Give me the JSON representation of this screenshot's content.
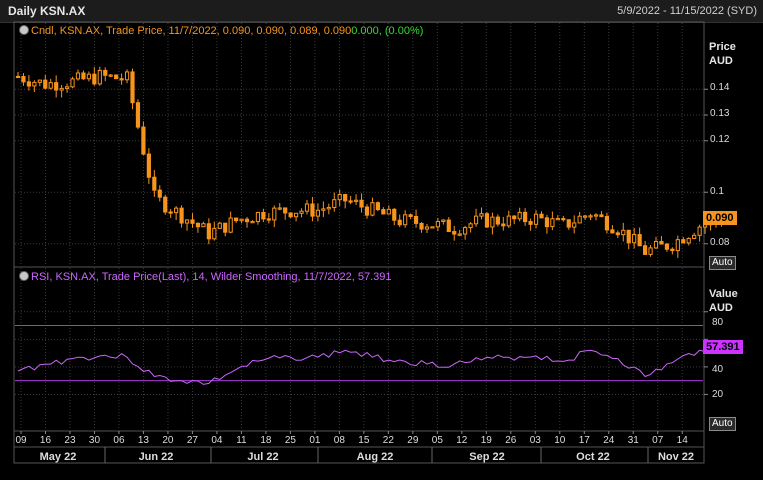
{
  "header": {
    "title": "Daily KSN.AX",
    "date_range": "5/9/2022 - 11/15/2022 (SYD)"
  },
  "price_panel": {
    "legend_prefix": "Cndl, KSN.AX, Trade Price, 11/7/2022, 0.090, 0.090, 0.089, 0.090",
    "legend_change": "0.000, (0.00%)",
    "axis_title_1": "Price",
    "axis_title_2": "AUD",
    "last_value_tag": "0.090",
    "auto_label": "Auto",
    "y_ticks": [
      "0.14",
      "0.13",
      "0.12",
      "0.1",
      "0.08"
    ]
  },
  "rsi_panel": {
    "legend": "RSI, KSN.AX, Trade Price(Last), 14, Wilder Smoothing, 11/7/2022, 57.391",
    "axis_title_1": "Value",
    "axis_title_2": "AUD",
    "last_value_tag": "57.391",
    "auto_label": "Auto",
    "y_ticks": [
      "80",
      "60",
      "40",
      "20"
    ]
  },
  "x_axis": {
    "day_ticks": [
      "09",
      "16",
      "23",
      "30",
      "06",
      "13",
      "20",
      "27",
      "04",
      "11",
      "18",
      "25",
      "01",
      "08",
      "15",
      "22",
      "29",
      "05",
      "12",
      "19",
      "26",
      "03",
      "10",
      "17",
      "24",
      "31",
      "07",
      "14"
    ],
    "month_labels": [
      "May 22",
      "Jun 22",
      "Jul 22",
      "Aug 22",
      "Sep 22",
      "Oct 22",
      "Nov 22"
    ]
  },
  "colors": {
    "candle": "#f7941d",
    "rsi_line": "#cc66ff",
    "rsi_band": "#a838d8",
    "grid": "#3a3a3a",
    "change_text": "#33dd33",
    "legend_price_text": "#f7941d",
    "legend_rsi_text": "#cc66ff",
    "price_tag_bg": "#f7941d",
    "rsi_tag_bg": "#cc33ff"
  },
  "chart_data": [
    {
      "type": "candlestick",
      "title": "Daily KSN.AX",
      "ylabel": "Price AUD",
      "ylim": [
        0.072,
        0.158
      ],
      "yticks": [
        0.08,
        0.1,
        0.12,
        0.13,
        0.14
      ],
      "last_value": 0.09,
      "grid": true,
      "approximate_closes": [
        {
          "x": "2022-05-09",
          "y": 0.145
        },
        {
          "x": "2022-05-16",
          "y": 0.142
        },
        {
          "x": "2022-05-23",
          "y": 0.143
        },
        {
          "x": "2022-05-30",
          "y": 0.145
        },
        {
          "x": "2022-06-06",
          "y": 0.144
        },
        {
          "x": "2022-06-13",
          "y": 0.098
        },
        {
          "x": "2022-06-20",
          "y": 0.091
        },
        {
          "x": "2022-06-27",
          "y": 0.084
        },
        {
          "x": "2022-07-04",
          "y": 0.089
        },
        {
          "x": "2022-07-11",
          "y": 0.092
        },
        {
          "x": "2022-07-18",
          "y": 0.093
        },
        {
          "x": "2022-07-25",
          "y": 0.093
        },
        {
          "x": "2022-08-01",
          "y": 0.097
        },
        {
          "x": "2022-08-08",
          "y": 0.093
        },
        {
          "x": "2022-08-15",
          "y": 0.089
        },
        {
          "x": "2022-08-22",
          "y": 0.088
        },
        {
          "x": "2022-08-29",
          "y": 0.086
        },
        {
          "x": "2022-09-05",
          "y": 0.089
        },
        {
          "x": "2022-09-12",
          "y": 0.089
        },
        {
          "x": "2022-09-19",
          "y": 0.09
        },
        {
          "x": "2022-09-26",
          "y": 0.087
        },
        {
          "x": "2022-10-03",
          "y": 0.092
        },
        {
          "x": "2022-10-10",
          "y": 0.086
        },
        {
          "x": "2022-10-17",
          "y": 0.077
        },
        {
          "x": "2022-10-24",
          "y": 0.08
        },
        {
          "x": "2022-10-31",
          "y": 0.087
        },
        {
          "x": "2022-11-07",
          "y": 0.09
        }
      ]
    },
    {
      "type": "line",
      "title": "RSI, KSN.AX, Trade Price(Last), 14, Wilder Smoothing",
      "ylabel": "Value AUD",
      "ylim": [
        5,
        90
      ],
      "yticks": [
        20,
        40,
        60,
        80
      ],
      "bands": [
        70,
        30
      ],
      "last_value": 57.391,
      "series": [
        {
          "name": "RSI, KSN.AX, Trade Price(Last), 14, Wilder Smoothing",
          "points": [
            {
              "x": "2022-05-09",
              "y": 37
            },
            {
              "x": "2022-05-16",
              "y": 42
            },
            {
              "x": "2022-05-23",
              "y": 46
            },
            {
              "x": "2022-05-30",
              "y": 48
            },
            {
              "x": "2022-06-06",
              "y": 47
            },
            {
              "x": "2022-06-13",
              "y": 33
            },
            {
              "x": "2022-06-20",
              "y": 30
            },
            {
              "x": "2022-06-27",
              "y": 28
            },
            {
              "x": "2022-07-04",
              "y": 38
            },
            {
              "x": "2022-07-11",
              "y": 45
            },
            {
              "x": "2022-07-18",
              "y": 47
            },
            {
              "x": "2022-07-25",
              "y": 47
            },
            {
              "x": "2022-08-01",
              "y": 52
            },
            {
              "x": "2022-08-08",
              "y": 47
            },
            {
              "x": "2022-08-15",
              "y": 45
            },
            {
              "x": "2022-08-22",
              "y": 42
            },
            {
              "x": "2022-08-29",
              "y": 42
            },
            {
              "x": "2022-09-05",
              "y": 45
            },
            {
              "x": "2022-09-12",
              "y": 47
            },
            {
              "x": "2022-09-19",
              "y": 48
            },
            {
              "x": "2022-09-26",
              "y": 44
            },
            {
              "x": "2022-10-03",
              "y": 52
            },
            {
              "x": "2022-10-10",
              "y": 46
            },
            {
              "x": "2022-10-17",
              "y": 33
            },
            {
              "x": "2022-10-24",
              "y": 43
            },
            {
              "x": "2022-10-31",
              "y": 52
            },
            {
              "x": "2022-11-07",
              "y": 57.391
            }
          ]
        }
      ]
    }
  ]
}
